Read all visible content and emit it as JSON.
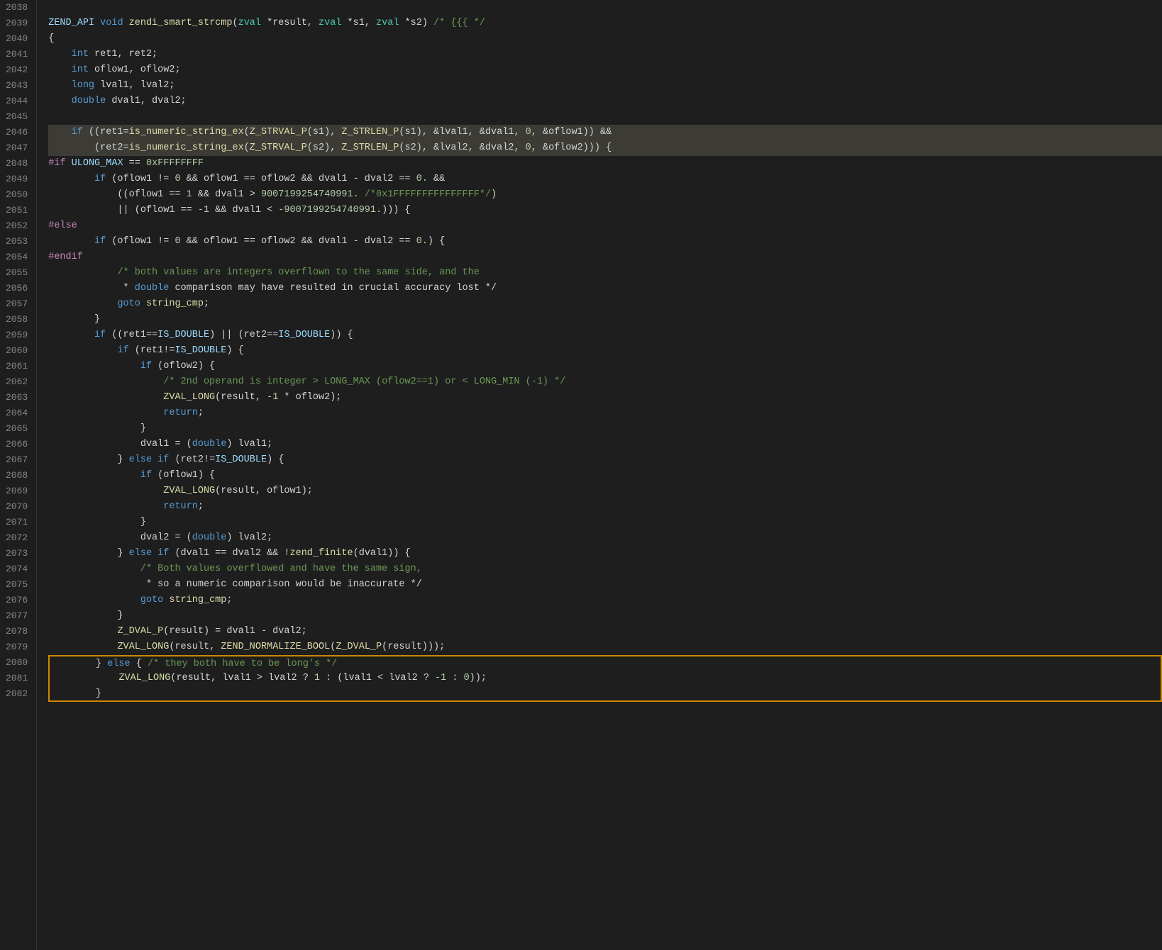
{
  "lines": [
    {
      "num": "2038",
      "content": "",
      "tokens": []
    },
    {
      "num": "2039",
      "content": "ZEND_API void zendi_smart_strcmp(zval *result, zval *s1, zval *s2) /* {{{ */",
      "highlight": false
    },
    {
      "num": "2040",
      "content": "{",
      "highlight": false
    },
    {
      "num": "2041",
      "content": "    int ret1, ret2;",
      "highlight": false
    },
    {
      "num": "2042",
      "content": "    int oflow1, oflow2;",
      "highlight": false
    },
    {
      "num": "2043",
      "content": "    long lval1, lval2;",
      "highlight": false
    },
    {
      "num": "2044",
      "content": "    double dval1, dval2;",
      "highlight": false
    },
    {
      "num": "2045",
      "content": "",
      "highlight": false
    },
    {
      "num": "2046",
      "content": "    if ((ret1=is_numeric_string_ex(Z_STRVAL_P(s1), Z_STRLEN_P(s1), &lval1, &dval1, 0, &oflow1)) &&",
      "highlight": true
    },
    {
      "num": "2047",
      "content": "        (ret2=is_numeric_string_ex(Z_STRVAL_P(s2), Z_STRLEN_P(s2), &lval2, &dval2, 0, &oflow2))) {",
      "highlight": true
    },
    {
      "num": "2048",
      "content": "#if ULONG_MAX == 0xFFFFFFFF",
      "highlight": false
    },
    {
      "num": "2049",
      "content": "        if (oflow1 != 0 && oflow1 == oflow2 && dval1 - dval2 == 0. &&",
      "highlight": false
    },
    {
      "num": "2050",
      "content": "            ((oflow1 == 1 && dval1 > 9007199254740991. /*0x1FFFFFFFFFFFFFFF*/)",
      "highlight": false
    },
    {
      "num": "2051",
      "content": "            || (oflow1 == -1 && dval1 < -9007199254740991.))) {",
      "highlight": false
    },
    {
      "num": "2052",
      "content": "#else",
      "highlight": false
    },
    {
      "num": "2053",
      "content": "        if (oflow1 != 0 && oflow1 == oflow2 && dval1 - dval2 == 0.) {",
      "highlight": false
    },
    {
      "num": "2054",
      "content": "#endif",
      "highlight": false
    },
    {
      "num": "2055",
      "content": "            /* both values are integers overflown to the same side, and the",
      "highlight": false
    },
    {
      "num": "2056",
      "content": "             * double comparison may have resulted in crucial accuracy lost */",
      "highlight": false
    },
    {
      "num": "2057",
      "content": "            goto string_cmp;",
      "highlight": false
    },
    {
      "num": "2058",
      "content": "        }",
      "highlight": false
    },
    {
      "num": "2059",
      "content": "        if ((ret1==IS_DOUBLE) || (ret2==IS_DOUBLE)) {",
      "highlight": false
    },
    {
      "num": "2060",
      "content": "            if (ret1!=IS_DOUBLE) {",
      "highlight": false
    },
    {
      "num": "2061",
      "content": "                if (oflow2) {",
      "highlight": false
    },
    {
      "num": "2062",
      "content": "                    /* 2nd operand is integer > LONG_MAX (oflow2==1) or < LONG_MIN (-1) */",
      "highlight": false
    },
    {
      "num": "2063",
      "content": "                    ZVAL_LONG(result, -1 * oflow2);",
      "highlight": false
    },
    {
      "num": "2064",
      "content": "                    return;",
      "highlight": false
    },
    {
      "num": "2065",
      "content": "                }",
      "highlight": false
    },
    {
      "num": "2066",
      "content": "                dval1 = (double) lval1;",
      "highlight": false
    },
    {
      "num": "2067",
      "content": "            } else if (ret2!=IS_DOUBLE) {",
      "highlight": false
    },
    {
      "num": "2068",
      "content": "                if (oflow1) {",
      "highlight": false
    },
    {
      "num": "2069",
      "content": "                    ZVAL_LONG(result, oflow1);",
      "highlight": false
    },
    {
      "num": "2070",
      "content": "                    return;",
      "highlight": false
    },
    {
      "num": "2071",
      "content": "                }",
      "highlight": false
    },
    {
      "num": "2072",
      "content": "                dval2 = (double) lval2;",
      "highlight": false
    },
    {
      "num": "2073",
      "content": "            } else if (dval1 == dval2 && !zend_finite(dval1)) {",
      "highlight": false
    },
    {
      "num": "2074",
      "content": "                /* Both values overflowed and have the same sign,",
      "highlight": false
    },
    {
      "num": "2075",
      "content": "                 * so a numeric comparison would be inaccurate */",
      "highlight": false
    },
    {
      "num": "2076",
      "content": "                goto string_cmp;",
      "highlight": false
    },
    {
      "num": "2077",
      "content": "            }",
      "highlight": false
    },
    {
      "num": "2078",
      "content": "            Z_DVAL_P(result) = dval1 - dval2;",
      "highlight": false
    },
    {
      "num": "2079",
      "content": "            ZVAL_LONG(result, ZEND_NORMALIZE_BOOL(Z_DVAL_P(result)));",
      "highlight": false
    },
    {
      "num": "2080",
      "content": "        } else { /* they both have to be long's */",
      "highlight": false,
      "boxed": "top"
    },
    {
      "num": "2081",
      "content": "            ZVAL_LONG(result, lval1 > lval2 ? 1 : (lval1 < lval2 ? -1 : 0));",
      "highlight": false,
      "boxed": "middle"
    },
    {
      "num": "2082",
      "content": "        }",
      "highlight": false,
      "boxed": "bottom"
    }
  ]
}
